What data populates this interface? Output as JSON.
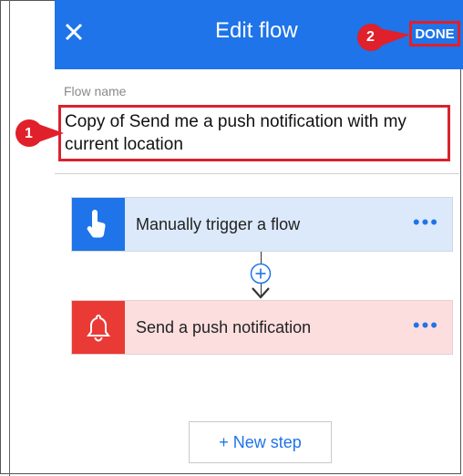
{
  "header": {
    "title": "Edit flow",
    "done_label": "DONE",
    "close_icon": "close-icon",
    "color": "#1e74e8"
  },
  "flow_name": {
    "label": "Flow name",
    "value": "Copy of Send me a push notification with my current location"
  },
  "steps": [
    {
      "label": "Manually trigger a flow",
      "icon": "hand-tap-icon",
      "menu": "•••",
      "icon_color": "#1e74e8",
      "bg": "#dbe9fb"
    },
    {
      "label": "Send a push notification",
      "icon": "bell-icon",
      "menu": "•••",
      "icon_color": "#ea3a36",
      "bg": "#fcdede"
    }
  ],
  "add_step_icon": "plus-circle-icon",
  "new_step_label": "+ New step",
  "callouts": [
    {
      "number": "1"
    },
    {
      "number": "2"
    }
  ],
  "callout_color": "#e0202a"
}
